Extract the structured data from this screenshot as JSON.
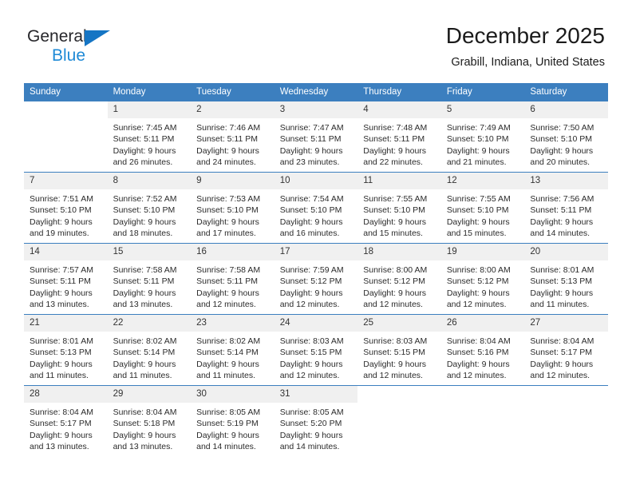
{
  "brand": {
    "name_top": "General",
    "name_bottom": "Blue",
    "triangle_color": "#1575c4",
    "blue_color": "#1f8ad6"
  },
  "header": {
    "title": "December 2025",
    "subtitle": "Grabill, Indiana, United States",
    "header_bg": "#3c7fbf",
    "daycell_bg": "#f0f0f0"
  },
  "weekdays": [
    "Sunday",
    "Monday",
    "Tuesday",
    "Wednesday",
    "Thursday",
    "Friday",
    "Saturday"
  ],
  "weeks": [
    [
      {
        "day": "",
        "empty": true,
        "sunrise": "",
        "sunset": "",
        "daylight_1": "",
        "daylight_2": ""
      },
      {
        "day": "1",
        "sunrise": "Sunrise: 7:45 AM",
        "sunset": "Sunset: 5:11 PM",
        "daylight_1": "Daylight: 9 hours",
        "daylight_2": "and 26 minutes."
      },
      {
        "day": "2",
        "sunrise": "Sunrise: 7:46 AM",
        "sunset": "Sunset: 5:11 PM",
        "daylight_1": "Daylight: 9 hours",
        "daylight_2": "and 24 minutes."
      },
      {
        "day": "3",
        "sunrise": "Sunrise: 7:47 AM",
        "sunset": "Sunset: 5:11 PM",
        "daylight_1": "Daylight: 9 hours",
        "daylight_2": "and 23 minutes."
      },
      {
        "day": "4",
        "sunrise": "Sunrise: 7:48 AM",
        "sunset": "Sunset: 5:11 PM",
        "daylight_1": "Daylight: 9 hours",
        "daylight_2": "and 22 minutes."
      },
      {
        "day": "5",
        "sunrise": "Sunrise: 7:49 AM",
        "sunset": "Sunset: 5:10 PM",
        "daylight_1": "Daylight: 9 hours",
        "daylight_2": "and 21 minutes."
      },
      {
        "day": "6",
        "sunrise": "Sunrise: 7:50 AM",
        "sunset": "Sunset: 5:10 PM",
        "daylight_1": "Daylight: 9 hours",
        "daylight_2": "and 20 minutes."
      }
    ],
    [
      {
        "day": "7",
        "sunrise": "Sunrise: 7:51 AM",
        "sunset": "Sunset: 5:10 PM",
        "daylight_1": "Daylight: 9 hours",
        "daylight_2": "and 19 minutes."
      },
      {
        "day": "8",
        "sunrise": "Sunrise: 7:52 AM",
        "sunset": "Sunset: 5:10 PM",
        "daylight_1": "Daylight: 9 hours",
        "daylight_2": "and 18 minutes."
      },
      {
        "day": "9",
        "sunrise": "Sunrise: 7:53 AM",
        "sunset": "Sunset: 5:10 PM",
        "daylight_1": "Daylight: 9 hours",
        "daylight_2": "and 17 minutes."
      },
      {
        "day": "10",
        "sunrise": "Sunrise: 7:54 AM",
        "sunset": "Sunset: 5:10 PM",
        "daylight_1": "Daylight: 9 hours",
        "daylight_2": "and 16 minutes."
      },
      {
        "day": "11",
        "sunrise": "Sunrise: 7:55 AM",
        "sunset": "Sunset: 5:10 PM",
        "daylight_1": "Daylight: 9 hours",
        "daylight_2": "and 15 minutes."
      },
      {
        "day": "12",
        "sunrise": "Sunrise: 7:55 AM",
        "sunset": "Sunset: 5:10 PM",
        "daylight_1": "Daylight: 9 hours",
        "daylight_2": "and 15 minutes."
      },
      {
        "day": "13",
        "sunrise": "Sunrise: 7:56 AM",
        "sunset": "Sunset: 5:11 PM",
        "daylight_1": "Daylight: 9 hours",
        "daylight_2": "and 14 minutes."
      }
    ],
    [
      {
        "day": "14",
        "sunrise": "Sunrise: 7:57 AM",
        "sunset": "Sunset: 5:11 PM",
        "daylight_1": "Daylight: 9 hours",
        "daylight_2": "and 13 minutes."
      },
      {
        "day": "15",
        "sunrise": "Sunrise: 7:58 AM",
        "sunset": "Sunset: 5:11 PM",
        "daylight_1": "Daylight: 9 hours",
        "daylight_2": "and 13 minutes."
      },
      {
        "day": "16",
        "sunrise": "Sunrise: 7:58 AM",
        "sunset": "Sunset: 5:11 PM",
        "daylight_1": "Daylight: 9 hours",
        "daylight_2": "and 12 minutes."
      },
      {
        "day": "17",
        "sunrise": "Sunrise: 7:59 AM",
        "sunset": "Sunset: 5:12 PM",
        "daylight_1": "Daylight: 9 hours",
        "daylight_2": "and 12 minutes."
      },
      {
        "day": "18",
        "sunrise": "Sunrise: 8:00 AM",
        "sunset": "Sunset: 5:12 PM",
        "daylight_1": "Daylight: 9 hours",
        "daylight_2": "and 12 minutes."
      },
      {
        "day": "19",
        "sunrise": "Sunrise: 8:00 AM",
        "sunset": "Sunset: 5:12 PM",
        "daylight_1": "Daylight: 9 hours",
        "daylight_2": "and 12 minutes."
      },
      {
        "day": "20",
        "sunrise": "Sunrise: 8:01 AM",
        "sunset": "Sunset: 5:13 PM",
        "daylight_1": "Daylight: 9 hours",
        "daylight_2": "and 11 minutes."
      }
    ],
    [
      {
        "day": "21",
        "sunrise": "Sunrise: 8:01 AM",
        "sunset": "Sunset: 5:13 PM",
        "daylight_1": "Daylight: 9 hours",
        "daylight_2": "and 11 minutes."
      },
      {
        "day": "22",
        "sunrise": "Sunrise: 8:02 AM",
        "sunset": "Sunset: 5:14 PM",
        "daylight_1": "Daylight: 9 hours",
        "daylight_2": "and 11 minutes."
      },
      {
        "day": "23",
        "sunrise": "Sunrise: 8:02 AM",
        "sunset": "Sunset: 5:14 PM",
        "daylight_1": "Daylight: 9 hours",
        "daylight_2": "and 11 minutes."
      },
      {
        "day": "24",
        "sunrise": "Sunrise: 8:03 AM",
        "sunset": "Sunset: 5:15 PM",
        "daylight_1": "Daylight: 9 hours",
        "daylight_2": "and 12 minutes."
      },
      {
        "day": "25",
        "sunrise": "Sunrise: 8:03 AM",
        "sunset": "Sunset: 5:15 PM",
        "daylight_1": "Daylight: 9 hours",
        "daylight_2": "and 12 minutes."
      },
      {
        "day": "26",
        "sunrise": "Sunrise: 8:04 AM",
        "sunset": "Sunset: 5:16 PM",
        "daylight_1": "Daylight: 9 hours",
        "daylight_2": "and 12 minutes."
      },
      {
        "day": "27",
        "sunrise": "Sunrise: 8:04 AM",
        "sunset": "Sunset: 5:17 PM",
        "daylight_1": "Daylight: 9 hours",
        "daylight_2": "and 12 minutes."
      }
    ],
    [
      {
        "day": "28",
        "sunrise": "Sunrise: 8:04 AM",
        "sunset": "Sunset: 5:17 PM",
        "daylight_1": "Daylight: 9 hours",
        "daylight_2": "and 13 minutes."
      },
      {
        "day": "29",
        "sunrise": "Sunrise: 8:04 AM",
        "sunset": "Sunset: 5:18 PM",
        "daylight_1": "Daylight: 9 hours",
        "daylight_2": "and 13 minutes."
      },
      {
        "day": "30",
        "sunrise": "Sunrise: 8:05 AM",
        "sunset": "Sunset: 5:19 PM",
        "daylight_1": "Daylight: 9 hours",
        "daylight_2": "and 14 minutes."
      },
      {
        "day": "31",
        "sunrise": "Sunrise: 8:05 AM",
        "sunset": "Sunset: 5:20 PM",
        "daylight_1": "Daylight: 9 hours",
        "daylight_2": "and 14 minutes."
      },
      {
        "day": "",
        "empty": true,
        "sunrise": "",
        "sunset": "",
        "daylight_1": "",
        "daylight_2": ""
      },
      {
        "day": "",
        "empty": true,
        "sunrise": "",
        "sunset": "",
        "daylight_1": "",
        "daylight_2": ""
      },
      {
        "day": "",
        "empty": true,
        "sunrise": "",
        "sunset": "",
        "daylight_1": "",
        "daylight_2": ""
      }
    ]
  ]
}
